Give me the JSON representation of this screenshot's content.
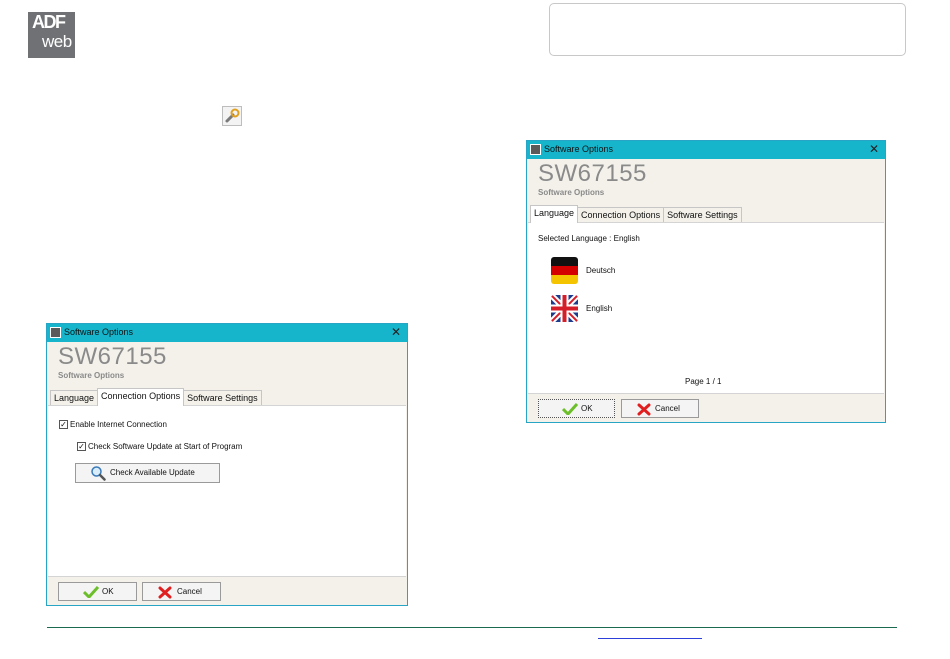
{
  "logo": {
    "line1": "ADF",
    "line2": "web"
  },
  "left_window": {
    "title": "Software Options",
    "product_name": "SW67155",
    "product_subtitle": "Software Options",
    "tabs": [
      "Language",
      "Connection Options",
      "Software Settings"
    ],
    "active_tab": "Connection Options",
    "enable_internet": {
      "label": "Enable Internet Connection",
      "checked": true
    },
    "check_update": {
      "label": "Check Software Update at Start of Program",
      "checked": true
    },
    "check_update_button": "Check Available Update",
    "ok_label": "OK",
    "cancel_label": "Cancel"
  },
  "right_window": {
    "title": "Software Options",
    "product_name": "SW67155",
    "product_subtitle": "Software Options",
    "tabs": [
      "Language",
      "Connection Options",
      "Software Settings"
    ],
    "active_tab": "Language",
    "selected_language": "Selected Language : English",
    "languages": [
      "Deutsch",
      "English"
    ],
    "page_indicator": "Page 1 / 1",
    "ok_label": "OK",
    "cancel_label": "Cancel"
  },
  "colors": {
    "titlebar": "#16b5cc",
    "window_bg": "#f3f1ea",
    "product_text": "#8a8a8a",
    "ok_check": "#6cbe2a",
    "cancel_x": "#e02020",
    "footer_line": "#1a6b4d"
  },
  "icons": [
    "wrench-icon",
    "window-app-icon",
    "close-icon",
    "checkmark-icon",
    "cancel-x-icon",
    "magnifier-icon",
    "germany-flag-icon",
    "uk-flag-icon"
  ]
}
